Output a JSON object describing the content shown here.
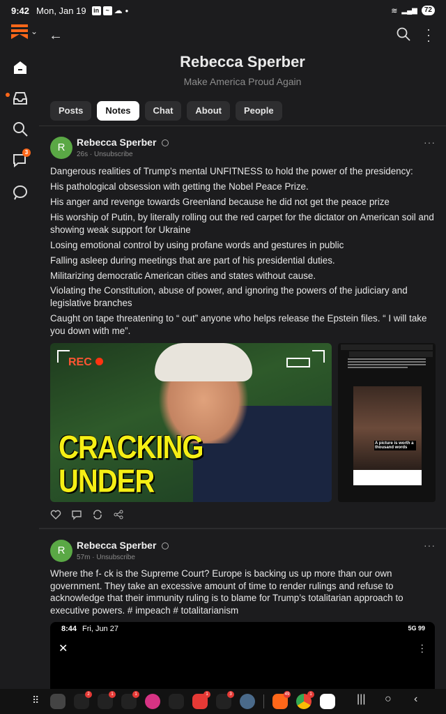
{
  "status_bar": {
    "time": "9:42",
    "date": "Mon, Jan 19",
    "battery": "72"
  },
  "publication": {
    "title": "Rebecca Sperber",
    "subtitle": "Make America Proud Again",
    "tabs": [
      "Posts",
      "Notes",
      "Chat",
      "About",
      "People"
    ],
    "active_tab": "Notes"
  },
  "rail": {
    "inbox_badge": "",
    "chat_badge": "3"
  },
  "notes": [
    {
      "avatar_letter": "R",
      "author": "Rebecca Sperber",
      "time": "26s",
      "action": "Unsubscribe",
      "paragraphs": [
        "Dangerous realities of Trump’s mental UNFITNESS to hold the power of the presidency:",
        "His pathological obsession with getting the Nobel Peace Prize.",
        "His anger and revenge towards Greenland because he did not get the peace prize",
        "His worship of Putin, by literally rolling out the red carpet for the dictator on American soil and showing weak support for Ukraine",
        "Losing emotional control by using profane words and gestures in public",
        "Falling asleep during meetings that are part of his presidential duties.",
        "Militarizing democratic American cities and states without cause.",
        "Violating the Constitution, abuse of power, and ignoring the powers of the judiciary and legislative branches",
        "Caught on tape threatening to “ out” anyone who helps release the Epstein files. “ I will take you down with me”."
      ],
      "image_rec": "REC",
      "image_headline": [
        "CRACKING",
        "UNDER PRESSURE!!!"
      ],
      "screenshot_caption": "A picture is worth a thousand words"
    },
    {
      "avatar_letter": "R",
      "author": "Rebecca Sperber",
      "time": "57m",
      "action": "Unsubscribe",
      "text": "Where the f- ck is the Supreme Court? Europe is backing us up more than our own government. They take an excessive amount of time to render rulings and refuse to acknowledge that their immunity ruling is to blame for Trump’s totalitarian approach to executive powers. # impeach # totalitarianism",
      "embed": {
        "time": "8:44",
        "date": "Fri, Jun 27",
        "signal": "5G",
        "battery": "99"
      }
    }
  ],
  "dock_badges": [
    "2",
    "1",
    "1",
    "1",
    "3",
    "49",
    "1"
  ]
}
